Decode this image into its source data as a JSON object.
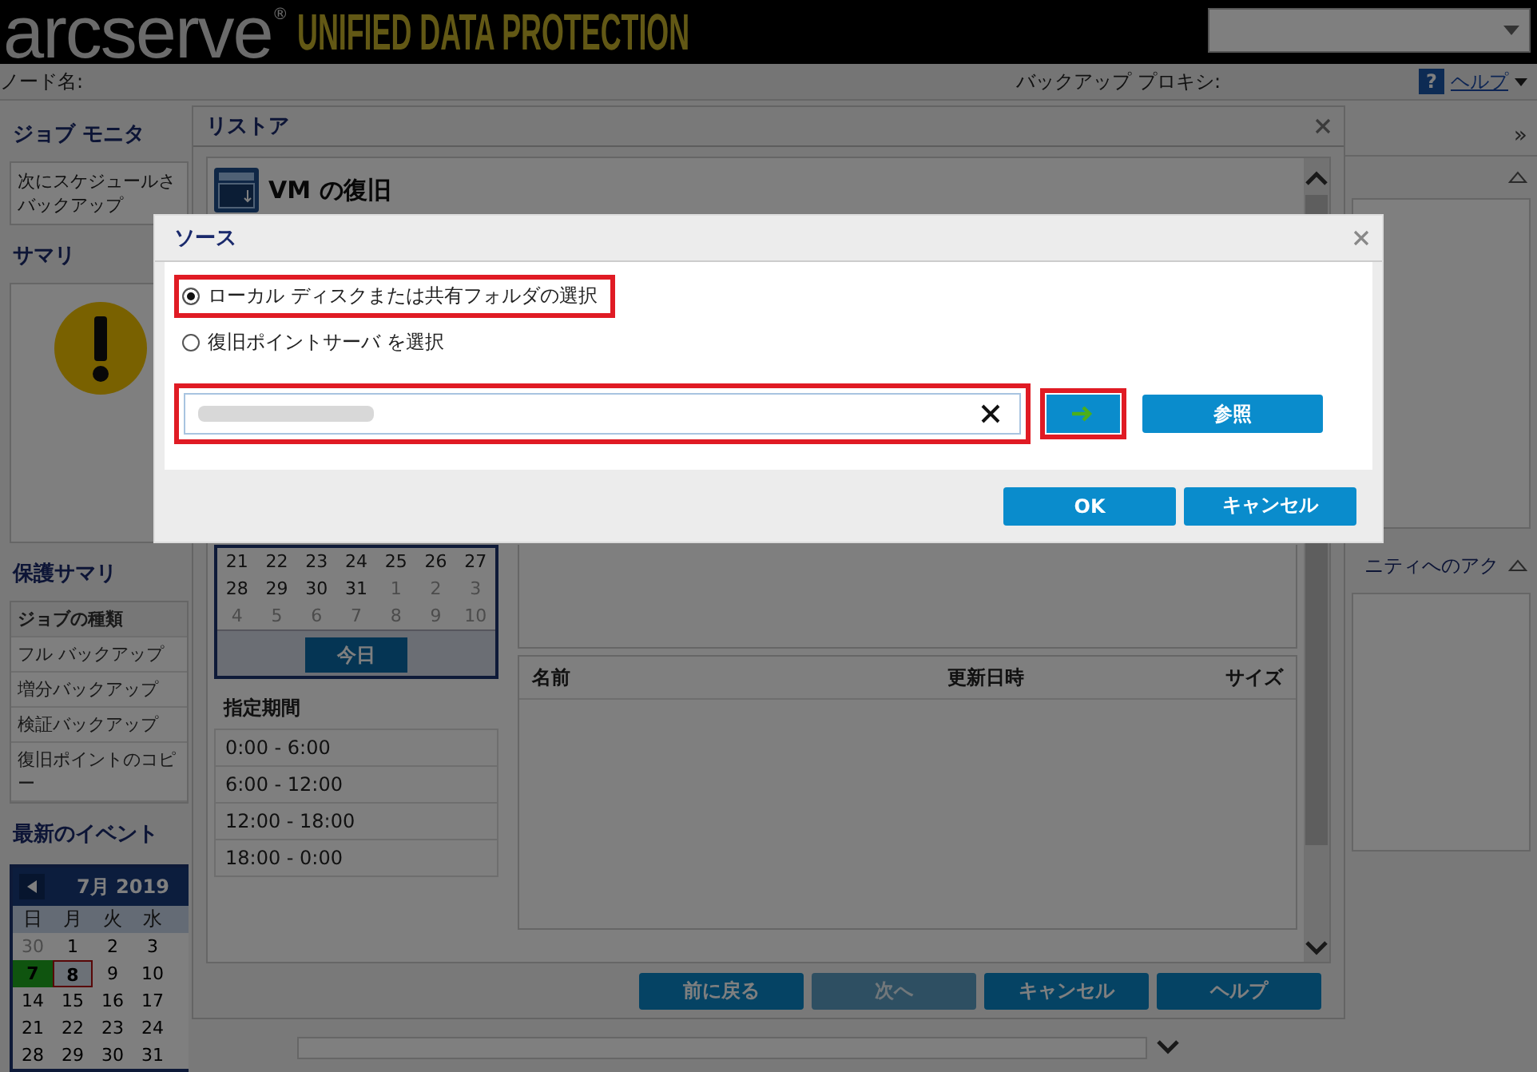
{
  "header": {
    "logo_text": "arcserve",
    "logo_mark": "®",
    "product": "UNIFIED DATA PROTECTION"
  },
  "topbar": {
    "node_label": "ノード名:",
    "proxy_label": "バックアップ プロキシ:",
    "help_icon": "?",
    "help_link": "ヘルプ"
  },
  "sidebar": {
    "job_monitor": {
      "title": "ジョブ モニタ",
      "lines": [
        "次にスケジュールさ",
        "バックアップ"
      ]
    },
    "summary": {
      "title": "サマリ"
    },
    "protection": {
      "title": "保護サマリ",
      "rows": [
        "ジョブの種類",
        "フル バックアップ",
        "増分バックアップ",
        "検証バックアップ",
        "復旧ポイントのコピー"
      ]
    },
    "events": {
      "title": "最新のイベント",
      "month": "7月 2019",
      "weekdays": [
        "日",
        "月",
        "火",
        "水"
      ],
      "weeks": [
        [
          {
            "day": "30",
            "muted": true,
            "backup": false,
            "today": false
          },
          {
            "day": "1",
            "muted": false,
            "backup": false,
            "today": false
          },
          {
            "day": "2",
            "muted": false,
            "backup": false,
            "today": false
          },
          {
            "day": "3",
            "muted": false,
            "backup": false,
            "today": false
          }
        ],
        [
          {
            "day": "7",
            "muted": false,
            "backup": true,
            "today": false
          },
          {
            "day": "8",
            "muted": false,
            "backup": false,
            "today": true
          },
          {
            "day": "9",
            "muted": false,
            "backup": false,
            "today": false
          },
          {
            "day": "10",
            "muted": false,
            "backup": false,
            "today": false
          }
        ],
        [
          {
            "day": "14",
            "muted": false,
            "backup": false,
            "today": false
          },
          {
            "day": "15",
            "muted": false,
            "backup": false,
            "today": false
          },
          {
            "day": "16",
            "muted": false,
            "backup": false,
            "today": false
          },
          {
            "day": "17",
            "muted": false,
            "backup": false,
            "today": false
          }
        ],
        [
          {
            "day": "21",
            "muted": false,
            "backup": false,
            "today": false
          },
          {
            "day": "22",
            "muted": false,
            "backup": false,
            "today": false
          },
          {
            "day": "23",
            "muted": false,
            "backup": false,
            "today": false
          },
          {
            "day": "24",
            "muted": false,
            "backup": false,
            "today": false
          }
        ],
        [
          {
            "day": "28",
            "muted": false,
            "backup": false,
            "today": false
          },
          {
            "day": "29",
            "muted": false,
            "backup": false,
            "today": false
          },
          {
            "day": "30",
            "muted": false,
            "backup": false,
            "today": false
          },
          {
            "day": "31",
            "muted": false,
            "backup": false,
            "today": false
          }
        ]
      ]
    }
  },
  "right_panel": {
    "expand_icon": "»",
    "heading": "ニティへのアク"
  },
  "restore": {
    "title": "リストア",
    "section": "VM の復旧",
    "calendar": {
      "weeks": [
        [
          {
            "day": "21",
            "muted": false
          },
          {
            "day": "22",
            "muted": false
          },
          {
            "day": "23",
            "muted": false
          },
          {
            "day": "24",
            "muted": false
          },
          {
            "day": "25",
            "muted": false
          },
          {
            "day": "26",
            "muted": false
          },
          {
            "day": "27",
            "muted": false
          }
        ],
        [
          {
            "day": "28",
            "muted": false
          },
          {
            "day": "29",
            "muted": false
          },
          {
            "day": "30",
            "muted": false
          },
          {
            "day": "31",
            "muted": false
          },
          {
            "day": "1",
            "muted": true
          },
          {
            "day": "2",
            "muted": true
          },
          {
            "day": "3",
            "muted": true
          }
        ],
        [
          {
            "day": "4",
            "muted": true
          },
          {
            "day": "5",
            "muted": true
          },
          {
            "day": "6",
            "muted": true
          },
          {
            "day": "7",
            "muted": true
          },
          {
            "day": "8",
            "muted": true
          },
          {
            "day": "9",
            "muted": true
          },
          {
            "day": "10",
            "muted": true
          }
        ]
      ],
      "today_button": "今日"
    },
    "period": {
      "title": "指定期間",
      "ranges": [
        "0:00 - 6:00",
        "6:00 - 12:00",
        "12:00 - 18:00",
        "18:00 - 0:00"
      ]
    },
    "files": {
      "columns": [
        "名前",
        "更新日時",
        "サイズ"
      ]
    },
    "buttons": [
      {
        "label": "前に戻る",
        "disabled": false
      },
      {
        "label": "次へ",
        "disabled": true
      },
      {
        "label": "キャンセル",
        "disabled": false
      },
      {
        "label": "ヘルプ",
        "disabled": false
      }
    ]
  },
  "dialog": {
    "title": "ソース",
    "options": [
      {
        "label": "ローカル ディスクまたは共有フォルダの選択",
        "selected": true,
        "highlighted": true
      },
      {
        "label": "復旧ポイントサーバ を選択",
        "selected": false,
        "highlighted": false
      }
    ],
    "path_field": {
      "highlighted": true
    },
    "go_button": {
      "highlighted": true
    },
    "browse_button": "参照",
    "buttons": [
      "OK",
      "キャンセル"
    ]
  }
}
